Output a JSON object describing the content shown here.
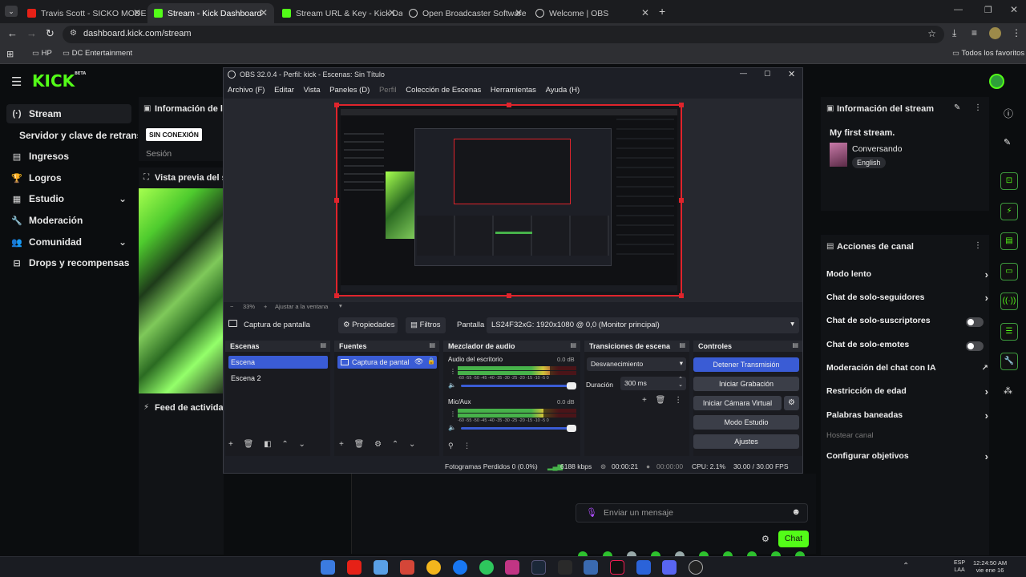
{
  "browser": {
    "tabs": [
      {
        "title": "Travis Scott - SICKO MODE (Off",
        "color": "#e62117"
      },
      {
        "title": "Stream - Kick Dashboard",
        "color": "#53fc18"
      },
      {
        "title": "Stream URL & Key - Kick Dashbo",
        "color": "#53fc18"
      },
      {
        "title": "Open Broadcaster Software | O",
        "color": "#cfcfcf"
      },
      {
        "title": "Welcome | OBS",
        "color": "#cfcfcf"
      }
    ],
    "url": "dashboard.kick.com/stream",
    "bookmarks": [
      "HP",
      "DC Entertainment"
    ],
    "all_bookmarks": "Todos los favoritos"
  },
  "kick": {
    "logo": "KICK",
    "logo_beta": "BETA",
    "nav": [
      {
        "label": "Stream",
        "icon": "stream-icon"
      },
      {
        "label": "Servidor y clave de retransmisión",
        "icon": ""
      },
      {
        "label": "Ingresos",
        "icon": "income-icon"
      },
      {
        "label": "Logros",
        "icon": "trophy-icon"
      },
      {
        "label": "Estudio",
        "icon": "studio-icon"
      },
      {
        "label": "Moderación",
        "icon": "wrench-icon"
      },
      {
        "label": "Comunidad",
        "icon": "community-icon"
      },
      {
        "label": "Drops y recompensas",
        "icon": "drops-icon"
      }
    ],
    "info_title": "Información de la stream",
    "offline_badge": "SIN CONEXIÓN",
    "session_label": "Sesión",
    "preview_title": "Vista previa del stream",
    "activity_title": "Feed de actividad",
    "stream_info": {
      "title": "Información del stream",
      "stream_name": "My first stream.",
      "category": "Conversando",
      "language": "English"
    },
    "channel_actions": {
      "title": "Acciones de canal",
      "items": [
        {
          "label": "Modo lento",
          "control": "arrow"
        },
        {
          "label": "Chat de solo-seguidores",
          "control": "arrow"
        },
        {
          "label": "Chat de solo-suscriptores",
          "control": "toggle"
        },
        {
          "label": "Chat de solo-emotes",
          "control": "toggle"
        },
        {
          "label": "Moderación del chat con IA",
          "control": "external"
        },
        {
          "label": "Restricción de edad",
          "control": "arrow"
        },
        {
          "label": "Palabras baneadas",
          "control": "arrow"
        },
        {
          "label": "Hostear canal",
          "control": "none"
        },
        {
          "label": "Configurar objetivos",
          "control": "arrow"
        }
      ]
    },
    "chat": {
      "placeholder": "Enviar un mensaje",
      "send_label": "Chat"
    }
  },
  "obs": {
    "title": "OBS 32.0.4 - Perfil: kick - Escenas: Sin Título",
    "menu": [
      "Archivo (F)",
      "Editar",
      "Vista",
      "Paneles (D)",
      "Perfil",
      "Colección de Escenas",
      "Herramientas",
      "Ayuda (H)"
    ],
    "zoom": "33%",
    "fit_label": "Ajustar a la ventana",
    "source_name": "Captura de pantalla",
    "properties_label": "Propiedades",
    "filters_label": "Filtros",
    "screen_label": "Pantalla",
    "screen_value": "LS24F32xG: 1920x1080 @ 0,0 (Monitor principal)",
    "scenes_title": "Escenas",
    "scenes": [
      "Escena",
      "Escena 2"
    ],
    "sources_title": "Fuentes",
    "sources": [
      "Captura de pantal"
    ],
    "mixer_title": "Mezclador de audio",
    "mixer": [
      {
        "name": "Audio del escritorio",
        "db": "0.0 dB",
        "level": 0.78
      },
      {
        "name": "Mic/Aux",
        "db": "0.0 dB",
        "level": 0.72
      }
    ],
    "meter_ticks": "-60 -55 -50 -45 -40 -35 -30 -25 -20 -15 -10 -5 0",
    "transitions_title": "Transiciones de escena",
    "transition": "Desvanecimiento",
    "duration_label": "Duración",
    "duration_value": "300 ms",
    "controls_title": "Controles",
    "controls": [
      "Detener Transmisión",
      "Iniciar Grabación",
      "Iniciar Cámara Virtual",
      "Modo Estudio",
      "Ajustes"
    ],
    "status": {
      "dropped": "Fotogramas Perdidos 0 (0.0%)",
      "kbps": "6188 kbps",
      "live_time": "00:00:21",
      "rec_time": "00:00:00",
      "cpu": "CPU: 2.1%",
      "fps": "30.00 / 30.00 FPS"
    }
  },
  "taskbar": {
    "lang": "ESP",
    "lang2": "LAA",
    "time": "12:24:50 AM",
    "date": "vie ene 16"
  }
}
